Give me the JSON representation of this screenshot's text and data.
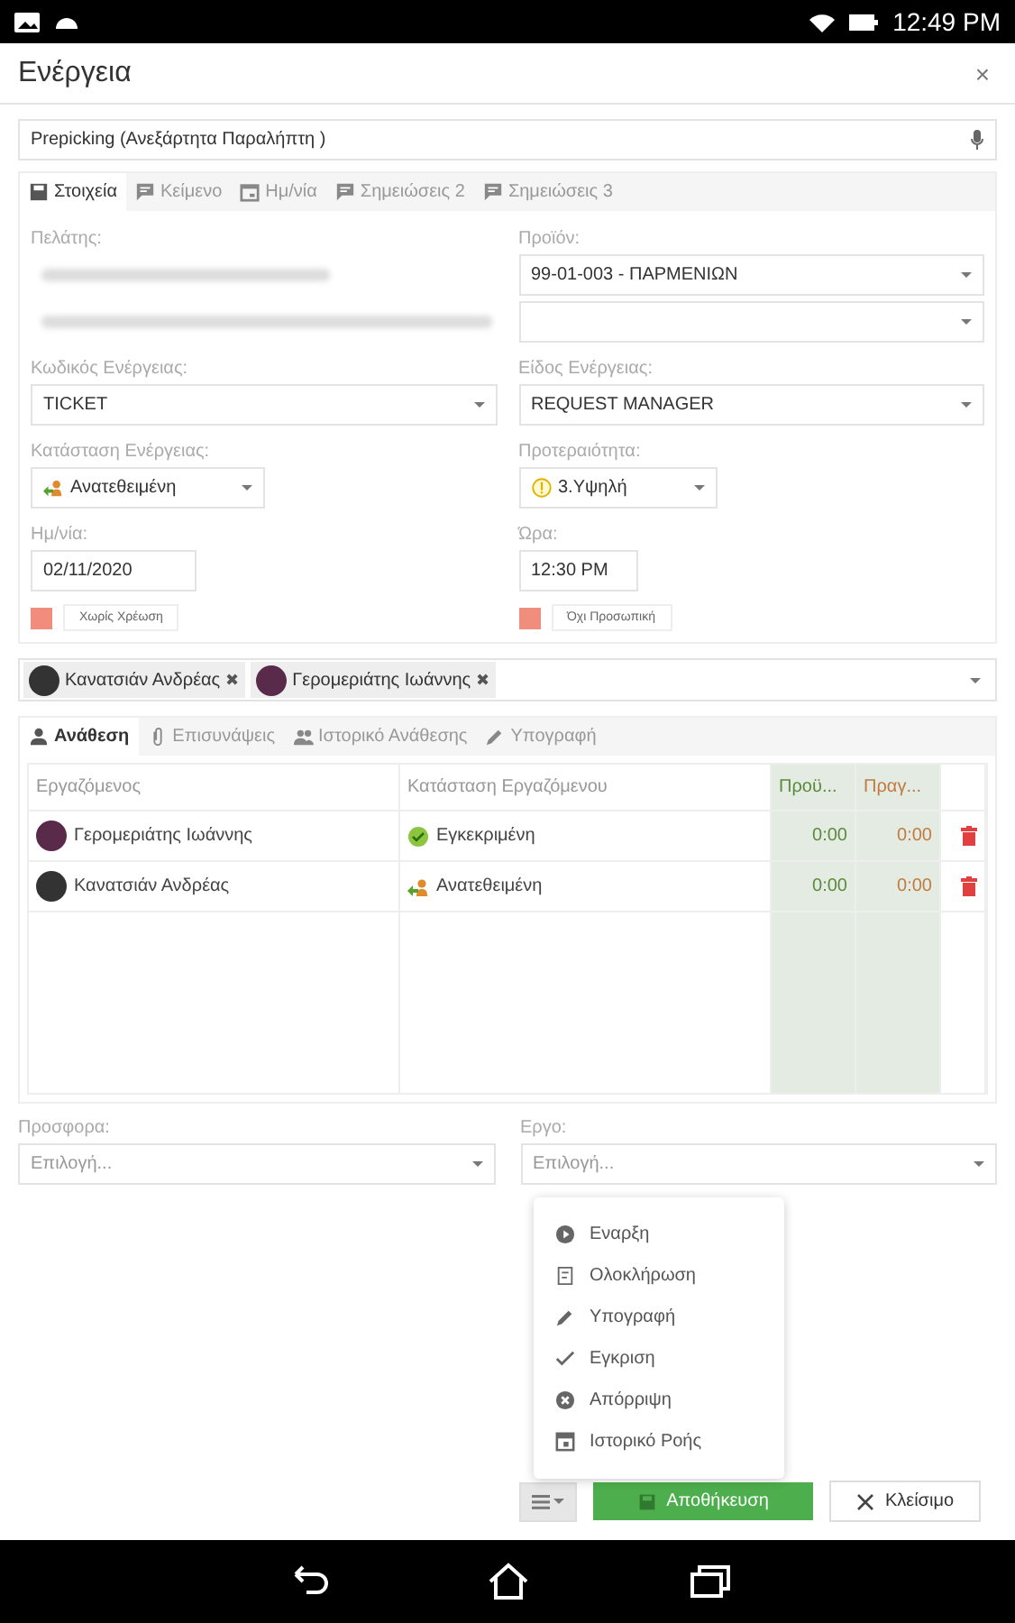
{
  "status_bar": {
    "time": "12:49 PM"
  },
  "dialog": {
    "title": "Ενέργεια",
    "close": "×"
  },
  "top_field": {
    "value": "Prepicking (Ανεξάρτητα Παραλήπτη )"
  },
  "tabs": [
    {
      "label": "Στοιχεία",
      "selected": true
    },
    {
      "label": "Κείμενο",
      "selected": false
    },
    {
      "label": "Ημ/νία",
      "selected": false
    },
    {
      "label": "Σημειώσεις 2",
      "selected": false
    },
    {
      "label": "Σημειώσεις 3",
      "selected": false
    }
  ],
  "customer": {
    "label": "Πελάτης:"
  },
  "product": {
    "label": "Προϊόν:",
    "value": "99-01-003 - ΠΑΡΜΕΝΙΩΝ"
  },
  "action_code": {
    "label": "Κωδικός Ενέργειας:",
    "value": "TICKET"
  },
  "action_type": {
    "label": "Είδος Ενέργειας:",
    "value": "REQUEST MANAGER"
  },
  "action_status": {
    "label": "Κατάσταση Ενέργειας:",
    "value": "Ανατεθειμένη"
  },
  "priority": {
    "label": "Προτεραιότητα:",
    "value": "3.Υψηλή"
  },
  "date": {
    "label": "Ημ/νία:",
    "value": "02/11/2020"
  },
  "time": {
    "label": "Ώρα:",
    "value": "12:30 PM"
  },
  "toggles": [
    {
      "label": "Χωρίς Χρέωση",
      "checked": true
    },
    {
      "label": "Όχι Προσωπική",
      "checked": true
    }
  ],
  "participants": [
    {
      "name": "Κανατσιάν Ανδρέας",
      "remove": "✖"
    },
    {
      "name": "Γερομεριάτης Ιωάννης",
      "remove": "✖"
    }
  ],
  "assign_tabs": [
    {
      "label": "Ανάθεση",
      "selected": true
    },
    {
      "label": "Επισυνάψεις",
      "selected": false
    },
    {
      "label": "Ιστορικό Ανάθεσης",
      "selected": false
    },
    {
      "label": "Υπογραφή",
      "selected": false
    }
  ],
  "table": {
    "columns": [
      "Εργαζόμενος",
      "Κατάσταση Εργαζόμενου",
      "Προϋ...",
      "Πραγ..."
    ],
    "rows": [
      {
        "employee": "Γερομεριάτης Ιωάννης",
        "status": "Εγκεκριμένη",
        "kind": "approved",
        "planned": "0:00",
        "actual": "0:00"
      },
      {
        "employee": "Κανατσιάν Ανδρέας",
        "status": "Ανατεθειμένη",
        "kind": "assigned",
        "planned": "0:00",
        "actual": "0:00"
      }
    ]
  },
  "offer": {
    "label": "Προσφορα:",
    "placeholder": "Επιλογή..."
  },
  "project": {
    "label": "Εργο:",
    "placeholder": "Επιλογή..."
  },
  "menu": [
    "Εναρξη",
    "Ολοκλήρωση",
    "Υπογραφή",
    "Εγκριση",
    "Απόρριψη",
    "Ιστορικό Ροής"
  ],
  "buttons": {
    "save": "Αποθήκευση",
    "close": "Κλείσιμο"
  }
}
